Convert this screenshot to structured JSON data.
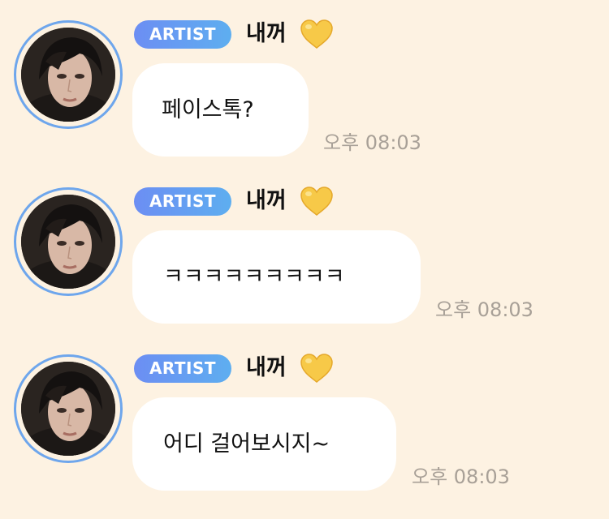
{
  "chat": {
    "messages": [
      {
        "badge": "ARTIST",
        "sender": "내꺼",
        "heart_icon": "yellow-heart-icon",
        "text": "페이스톡?",
        "time": "오후 08:03"
      },
      {
        "badge": "ARTIST",
        "sender": "내꺼",
        "heart_icon": "yellow-heart-icon",
        "text": "ㅋㅋㅋㅋㅋㅋㅋㅋㅋ",
        "time": "오후 08:03"
      },
      {
        "badge": "ARTIST",
        "sender": "내꺼",
        "heart_icon": "yellow-heart-icon",
        "text": "어디 걸어보시지~",
        "time": "오후 08:03"
      }
    ]
  },
  "colors": {
    "background": "#fdf2e2",
    "bubble": "#ffffff",
    "badge_gradient_start": "#6c8ef3",
    "badge_gradient_end": "#5eaef0",
    "avatar_ring": "#6ea6ec",
    "timestamp": "#a8a097",
    "heart": "#f7c948"
  }
}
